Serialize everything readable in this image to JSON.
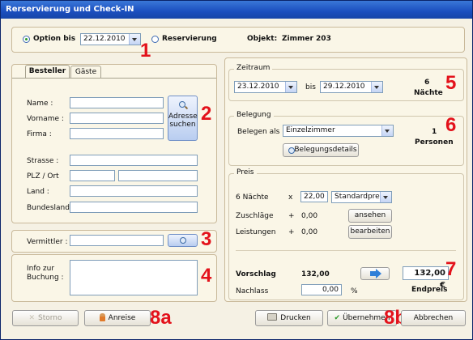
{
  "window": {
    "title": "Rerservierung und Check-IN"
  },
  "top": {
    "option_label": "Option bis",
    "option_date": "22.12.2010",
    "reserv_label": "Reservierung",
    "objekt_label": "Objekt:",
    "objekt_value": "Zimmer 203",
    "marker": "1"
  },
  "tabs": {
    "besteller": "Besteller",
    "gaeste": "Gäste"
  },
  "besteller": {
    "name": "Name :",
    "vorname": "Vorname :",
    "firma": "Firma :",
    "strasse": "Strasse :",
    "plz_ort": "PLZ / Ort",
    "land": "Land :",
    "bundesland": "Bundesland :",
    "adresse_btn_1": "Adresse",
    "adresse_btn_2": "suchen",
    "marker": "2"
  },
  "vermittler": {
    "label": "Vermittler :",
    "marker": "3"
  },
  "info": {
    "label_1": "Info zur",
    "label_2": "Buchung :",
    "marker": "4"
  },
  "zeitraum": {
    "legend": "Zeitraum",
    "from": "23.12.2010",
    "bis": "bis",
    "to": "29.12.2010",
    "naechte_count": "6",
    "naechte_label": "Nächte",
    "marker": "5"
  },
  "belegung": {
    "legend": "Belegung",
    "belegen_als": "Belegen als",
    "zimmertyp": "Einzelzimmer",
    "details_btn": "Belegungsdetails",
    "personen_count": "1",
    "personen_label": "Personen",
    "marker": "6"
  },
  "preis": {
    "legend": "Preis",
    "naechte": "6 Nächte",
    "times": "x",
    "einzelpreis": "22,00",
    "preisart": "Standardpreis",
    "zuschlaege": "Zuschläge",
    "plus": "+",
    "zuschlaege_value": "0,00",
    "ansehen_btn": "ansehen",
    "leistungen": "Leistungen",
    "leistungen_value": "0,00",
    "bearbeiten_btn": "bearbeiten",
    "vorschlag": "Vorschlag",
    "vorschlag_value": "132,00",
    "endpreis_value": "132,00 €",
    "endpreis_label": "Endpreis",
    "nachlass": "Nachlass",
    "nachlass_value": "0,00",
    "percent": "%",
    "marker": "7"
  },
  "footer": {
    "storno": "Storno",
    "anreise": "Anreise",
    "marker_a": "8a",
    "drucken": "Drucken",
    "uebernehmen": "Übernehmen",
    "marker_b": "8b",
    "abbrechen": "Abbrechen"
  },
  "colors": {
    "titlebar": "#1b4fbf",
    "marker": "#e3121b",
    "panel": "#faf6e7"
  }
}
